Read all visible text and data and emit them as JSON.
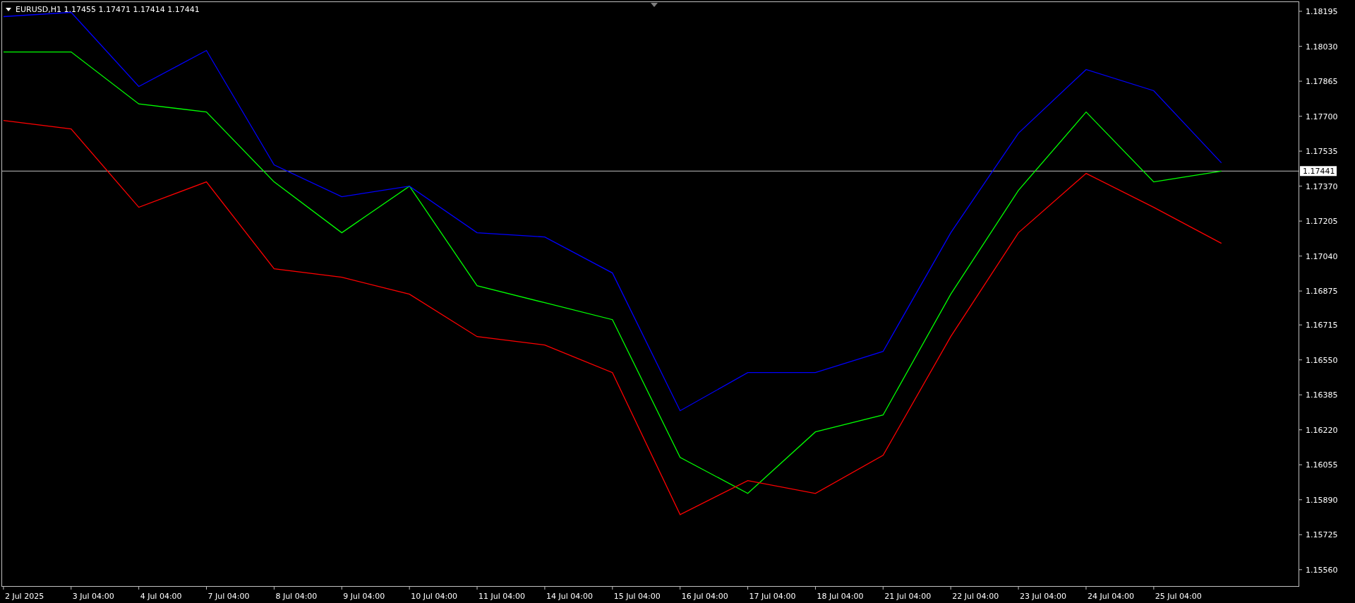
{
  "chart_header": {
    "symbol": "EURUSD,H1",
    "open": "1.17455",
    "high": "1.17471",
    "low": "1.17414",
    "close": "1.17441"
  },
  "chart_data": {
    "type": "line",
    "categories": [
      "2 Jul 2025",
      "3 Jul 04:00",
      "4 Jul 04:00",
      "7 Jul 04:00",
      "8 Jul 04:00",
      "9 Jul 04:00",
      "10 Jul 04:00",
      "11 Jul 04:00",
      "14 Jul 04:00",
      "15 Jul 04:00",
      "16 Jul 04:00",
      "17 Jul 04:00",
      "18 Jul 04:00",
      "21 Jul 04:00",
      "22 Jul 04:00",
      "23 Jul 04:00",
      "24 Jul 04:00",
      "25 Jul 04:00",
      null
    ],
    "yticks": [
      {
        "value": 1.18195,
        "label": "1.18195"
      },
      {
        "value": 1.1803,
        "label": "1.18030"
      },
      {
        "value": 1.17865,
        "label": "1.17865"
      },
      {
        "value": 1.177,
        "label": "1.17700"
      },
      {
        "value": 1.17535,
        "label": "1.17535"
      },
      {
        "value": 1.1737,
        "label": "1.17370"
      },
      {
        "value": 1.17205,
        "label": "1.17205"
      },
      {
        "value": 1.1704,
        "label": "1.17040"
      },
      {
        "value": 1.16875,
        "label": "1.16875"
      },
      {
        "value": 1.16715,
        "label": "1.16715"
      },
      {
        "value": 1.1655,
        "label": "1.16550"
      },
      {
        "value": 1.16385,
        "label": "1.16385"
      },
      {
        "value": 1.1622,
        "label": "1.16220"
      },
      {
        "value": 1.16055,
        "label": "1.16055"
      },
      {
        "value": 1.1589,
        "label": "1.15890"
      },
      {
        "value": 1.15725,
        "label": "1.15725"
      },
      {
        "value": 1.1556,
        "label": "1.15560"
      }
    ],
    "ylim": [
      1.15481,
      1.1824
    ],
    "ref_lines": [
      {
        "axis": "y",
        "value": 1.17441,
        "label": "1.17441"
      }
    ],
    "series": [
      {
        "color": "#00ff00",
        "values": [
          1.18003,
          1.18003,
          1.17758,
          1.1772,
          1.1739,
          1.1715,
          1.1737,
          1.169,
          1.1682,
          1.1674,
          1.1609,
          1.1592,
          1.1621,
          1.1629,
          1.1686,
          1.1735,
          1.1772,
          1.1739,
          1.17441
        ]
      },
      {
        "color": "#0000ff",
        "values": [
          1.1817,
          1.1819,
          1.1784,
          1.1801,
          1.1747,
          1.1732,
          1.1737,
          1.1715,
          1.1713,
          1.1696,
          1.1631,
          1.1649,
          1.1649,
          1.1659,
          1.1715,
          1.1762,
          1.1792,
          1.1782,
          1.1748
        ]
      },
      {
        "color": "#ff0000",
        "values": [
          1.1768,
          1.1764,
          1.1727,
          1.1739,
          1.1698,
          1.1694,
          1.1686,
          1.1666,
          1.1662,
          1.1649,
          1.1582,
          1.1598,
          1.1592,
          1.161,
          1.1666,
          1.1715,
          1.1743,
          1.1727,
          1.171
        ]
      }
    ]
  }
}
